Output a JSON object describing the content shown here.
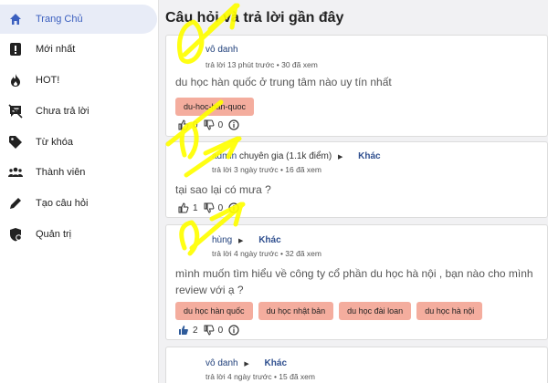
{
  "sidebar": {
    "items": [
      {
        "label": "Trang Chủ",
        "icon": "home-icon",
        "active": true
      },
      {
        "label": "Mới nhất",
        "icon": "exclamation-icon",
        "active": false
      },
      {
        "label": "HOT!",
        "icon": "fire-icon",
        "active": false
      },
      {
        "label": "Chưa trả lời",
        "icon": "unanswered-icon",
        "active": false
      },
      {
        "label": "Từ khóa",
        "icon": "tag-icon",
        "active": false
      },
      {
        "label": "Thành viên",
        "icon": "users-icon",
        "active": false
      },
      {
        "label": "Tạo câu hỏi",
        "icon": "pencil-icon",
        "active": false
      },
      {
        "label": "Quản trị",
        "icon": "shield-icon",
        "active": false
      }
    ]
  },
  "main": {
    "title": "Câu hỏi và trả lời gần đây"
  },
  "questions": [
    {
      "user": "vô danh",
      "badge": "",
      "category": "",
      "time": "trả lời 13 phút trước • 30 đã xem",
      "title": "du học hàn quốc ở trung tâm nào uy tín nhất",
      "tags": [
        "du-hoc-han-quoc"
      ],
      "likes": "0",
      "dislikes": "0",
      "answers": "0"
    },
    {
      "user": "admin",
      "badge": "chuyên gia (1.1k điểm)",
      "category": "Khác",
      "time": "trả lời 3 ngày trước • 16 đã xem",
      "title": "tại sao lại có mưa ?",
      "tags": [],
      "likes": "1",
      "dislikes": "0",
      "answers": "0"
    },
    {
      "user": "hùng",
      "badge": "",
      "category": "Khác",
      "time": "trả lời 4 ngày trước • 32 đã xem",
      "title": "mình muốn tìm hiểu về công ty cổ phần du học hà nội , bạn nào cho mình review với ạ ?",
      "tags": [
        "du học hàn quốc",
        "du học nhật bản",
        "du học đài loan",
        "du học hà nội"
      ],
      "likes": "2",
      "dislikes": "0",
      "answers": "0"
    },
    {
      "user": "vô danh",
      "badge": "",
      "category": "Khác",
      "time": "trả lời 4 ngày trước • 15 đã xem",
      "title": "",
      "tags": [],
      "likes": "",
      "dislikes": "",
      "answers": ""
    }
  ],
  "colors": {
    "active_nav_bg": "#e8ecf7",
    "active_nav_text": "#3b5fbf",
    "tag_bg": "#f4ad9e",
    "link": "#1f3f7a",
    "scribble": "#ffff00"
  }
}
